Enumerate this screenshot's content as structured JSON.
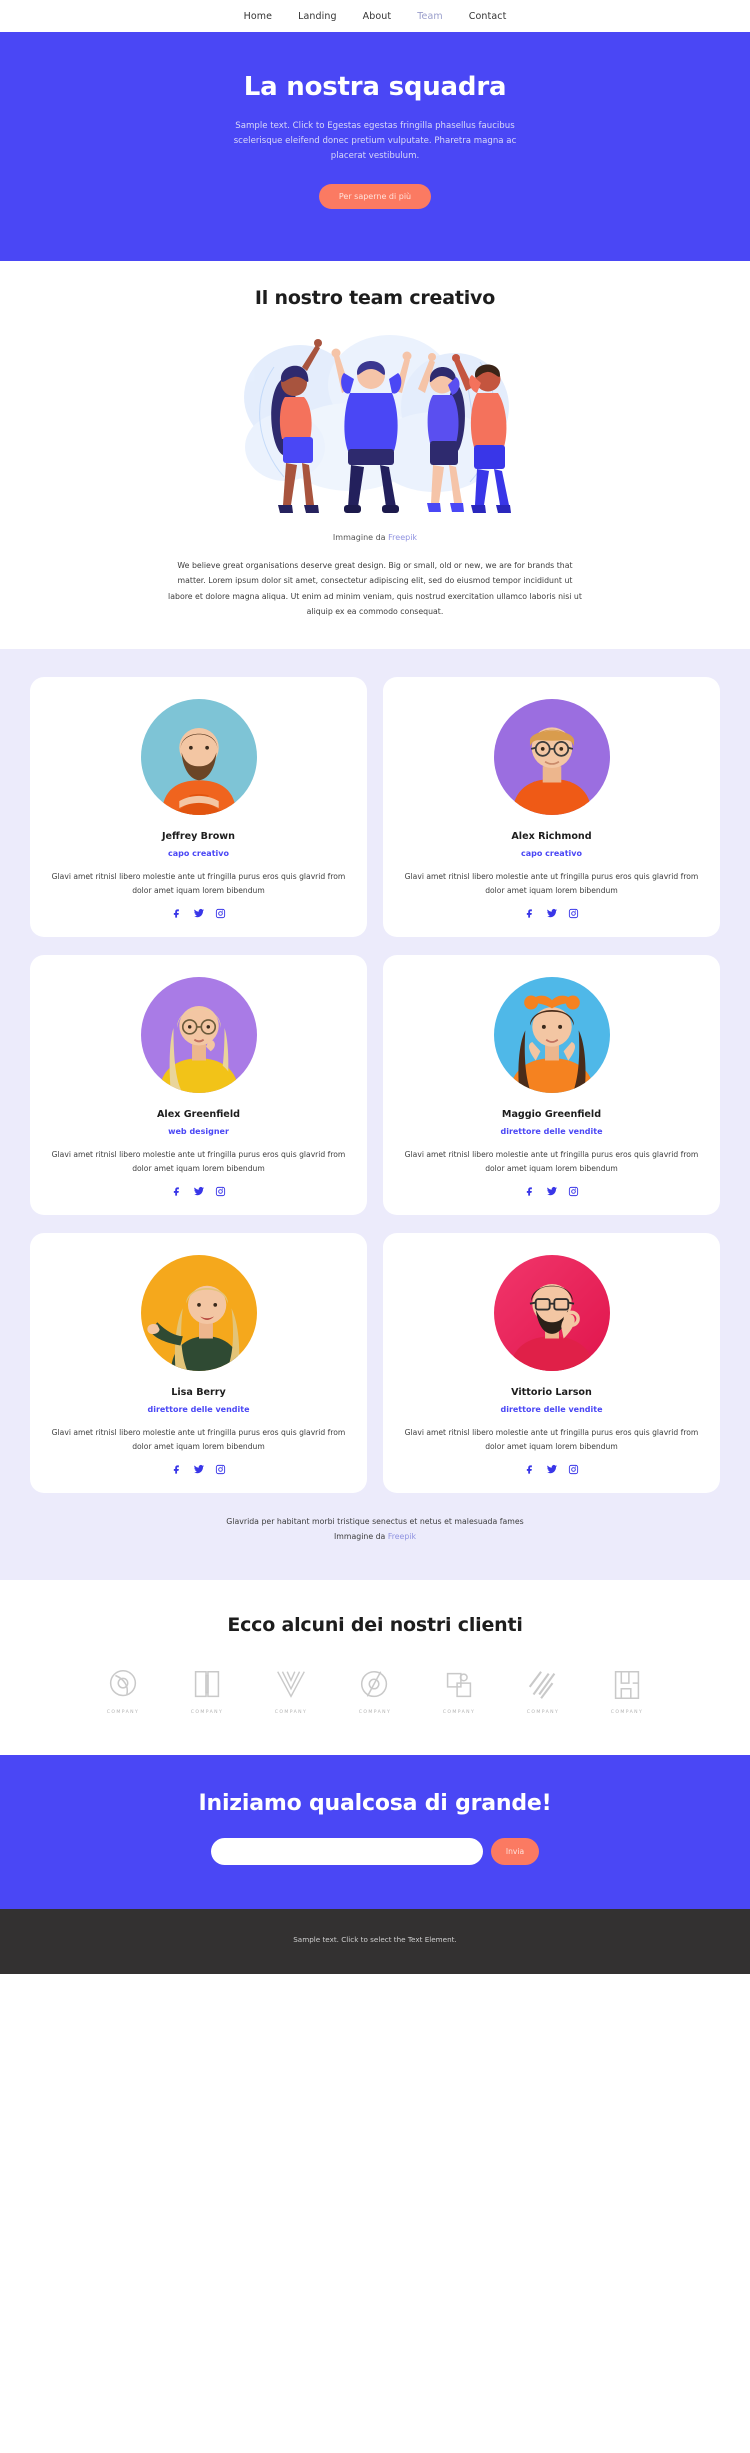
{
  "nav": {
    "items": [
      {
        "label": "Home",
        "active": false
      },
      {
        "label": "Landing",
        "active": false
      },
      {
        "label": "About",
        "active": false
      },
      {
        "label": "Team",
        "active": true
      },
      {
        "label": "Contact",
        "active": false
      }
    ]
  },
  "hero": {
    "title": "La nostra squadra",
    "subtitle": "Sample text. Click to Egestas egestas fringilla phasellus faucibus scelerisque eleifend donec pretium vulputate. Pharetra magna ac placerat vestibulum.",
    "cta_label": "Per saperne di più"
  },
  "creative": {
    "title": "Il nostro team creativo",
    "credit_prefix": "Immagine da ",
    "credit_link": "Freepik",
    "paragraph": "We believe great organisations deserve great design. Big or small, old or new, we are for brands that matter. Lorem ipsum dolor sit amet, consectetur adipiscing elit, sed do eiusmod tempor incididunt ut labore et dolore magna aliqua. Ut enim ad minim veniam, quis nostrud exercitation ullamco laboris nisi ut aliquip ex ea commodo consequat."
  },
  "team": {
    "members": [
      {
        "name": "Jeffrey Brown",
        "role": "capo creativo",
        "bio": "Glavi amet ritnisl libero molestie ante ut fringilla purus eros quis glavrid from dolor amet iquam lorem bibendum",
        "avatar_bg": "#7ec4d6",
        "shirt": "#f0641e",
        "hair": "#5b3a22",
        "skin": "#f3c6a3",
        "beard": true,
        "glasses": false
      },
      {
        "name": "Alex Richmond",
        "role": "capo creativo",
        "bio": "Glavi amet ritnisl libero molestie ante ut fringilla purus eros quis glavrid from dolor amet iquam lorem bibendum",
        "avatar_bg": "#9b6ee0",
        "shirt": "#ef5a16",
        "hair": "#c98b3c",
        "skin": "#f3c6a3",
        "beard": false,
        "glasses": true
      },
      {
        "name": "Alex Greenfield",
        "role": "web designer",
        "bio": "Glavi amet ritnisl libero molestie ante ut fringilla purus eros quis glavrid from dolor amet iquam lorem bibendum",
        "avatar_bg": "#a97be6",
        "shirt": "#f2c318",
        "hair": "#e9d49a",
        "skin": "#f3c6a3",
        "beard": false,
        "glasses": true
      },
      {
        "name": "Maggio Greenfield",
        "role": "direttore delle vendite",
        "bio": "Glavi amet ritnisl libero molestie ante ut fringilla purus eros quis glavrid from dolor amet iquam lorem bibendum",
        "avatar_bg": "#4fb8e8",
        "shirt": "#f58220",
        "hair": "#4a2c1a",
        "skin": "#f3c6a3",
        "beard": false,
        "glasses": false
      },
      {
        "name": "Lisa Berry",
        "role": "direttore delle vendite",
        "bio": "Glavi amet ritnisl libero molestie ante ut fringilla purus eros quis glavrid from dolor amet iquam lorem bibendum",
        "avatar_bg": "#f5a81c",
        "shirt": "#2f4a33",
        "hair": "#e3c478",
        "skin": "#f3c6a3",
        "beard": false,
        "glasses": false
      },
      {
        "name": "Vittorio Larson",
        "role": "direttore delle vendite",
        "bio": "Glavi amet ritnisl libero molestie ante ut fringilla purus eros quis glavrid from dolor amet iquam lorem bibendum",
        "avatar_bg": "#ef2d5e",
        "shirt": "#e02048",
        "hair": "#2b2118",
        "skin": "#f3c6a3",
        "beard": true,
        "glasses": true
      }
    ],
    "socials": [
      "facebook-icon",
      "twitter-icon",
      "instagram-icon"
    ],
    "footnote_line1": "Glavrida per habitant morbi tristique senectus et netus et malesuada fames",
    "footnote_prefix": "Immagine da ",
    "footnote_link": "Freepik"
  },
  "clients": {
    "title": "Ecco alcuni dei nostri clienti",
    "logos": [
      {
        "caption": "COMPANY",
        "glyph": "ring"
      },
      {
        "caption": "COMPANY",
        "glyph": "book"
      },
      {
        "caption": "COMPANY",
        "glyph": "wave"
      },
      {
        "caption": "COMPANY",
        "glyph": "circle-slash"
      },
      {
        "caption": "COMPANY",
        "glyph": "square-dot"
      },
      {
        "caption": "COMPANY",
        "glyph": "diagonal-lines"
      },
      {
        "caption": "COMPANY",
        "glyph": "bracket-frame"
      }
    ]
  },
  "cta": {
    "title": "Iniziamo qualcosa di grande!",
    "input_value": "",
    "input_placeholder": "",
    "submit_label": "Invia"
  },
  "footer": {
    "text": "Sample text. Click to select the Text Element."
  },
  "colors": {
    "brand_blue": "#4a47f5",
    "coral": "#fb7a62",
    "lavender_bg": "#ecebfb",
    "footer_dark": "#333131",
    "link": "#8f92e0"
  }
}
